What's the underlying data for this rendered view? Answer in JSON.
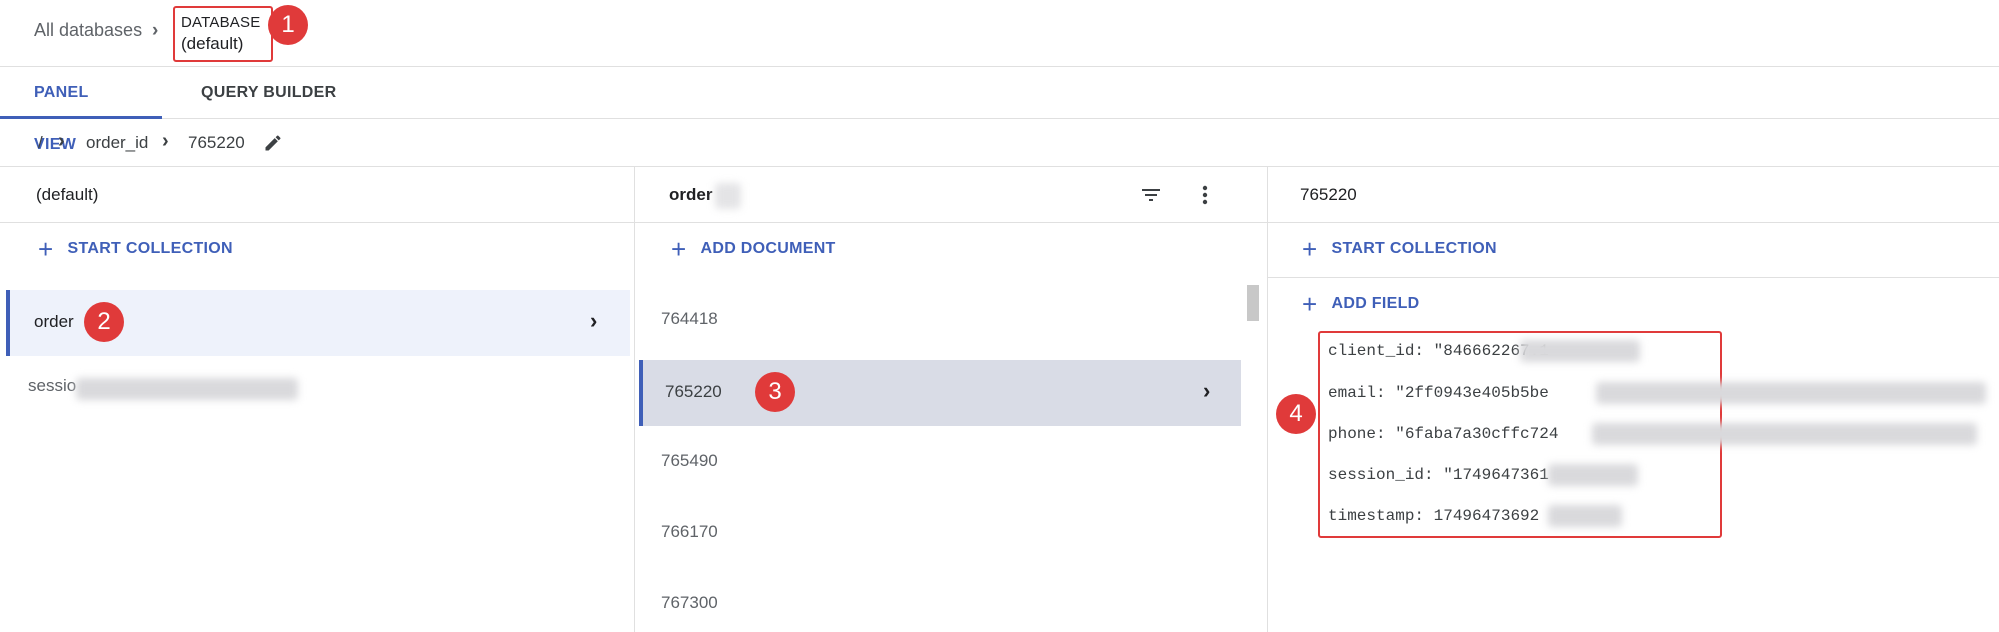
{
  "breadcrumb": {
    "all_databases": "All databases",
    "database_label": "DATABASE",
    "database_name": "(default)"
  },
  "annotations": [
    "1",
    "2",
    "3",
    "4"
  ],
  "tabs": [
    {
      "label": "PANEL VIEW",
      "active": true
    },
    {
      "label": "QUERY BUILDER",
      "active": false
    }
  ],
  "path": {
    "root": "/",
    "collection": "order_id",
    "document": "765220"
  },
  "columns": {
    "root": {
      "title": "(default)",
      "action": "START COLLECTION",
      "items": [
        {
          "label": "order",
          "selected": true
        },
        {
          "label": "sessio",
          "selected": false
        }
      ]
    },
    "collection": {
      "title": "order",
      "action": "ADD DOCUMENT",
      "items": [
        {
          "label": "764418",
          "selected": false
        },
        {
          "label": "765220",
          "selected": true
        },
        {
          "label": "765490",
          "selected": false
        },
        {
          "label": "766170",
          "selected": false
        },
        {
          "label": "767300",
          "selected": false
        }
      ]
    },
    "document": {
      "title": "765220",
      "action_collection": "START COLLECTION",
      "action_field": "ADD FIELD",
      "fields": [
        {
          "key": "client_id:",
          "value": "\"846662267.1"
        },
        {
          "key": "email:",
          "value": "\"2ff0943e405b5be"
        },
        {
          "key": "phone:",
          "value": "\"6faba7a30cffc724"
        },
        {
          "key": "session_id:",
          "value": "\"1749647361"
        },
        {
          "key": "timestamp:",
          "value": "17496473692"
        }
      ]
    }
  },
  "icons": {
    "chevron": "›",
    "edit": "pencil-icon",
    "filter": "filter-icon",
    "more": "more-vert-icon",
    "plus": "+"
  },
  "colors": {
    "accent": "#3f5fb8",
    "annotation": "#e03a3a",
    "selected_row": "#eef2fb",
    "selected_doc": "#d9dce6"
  }
}
